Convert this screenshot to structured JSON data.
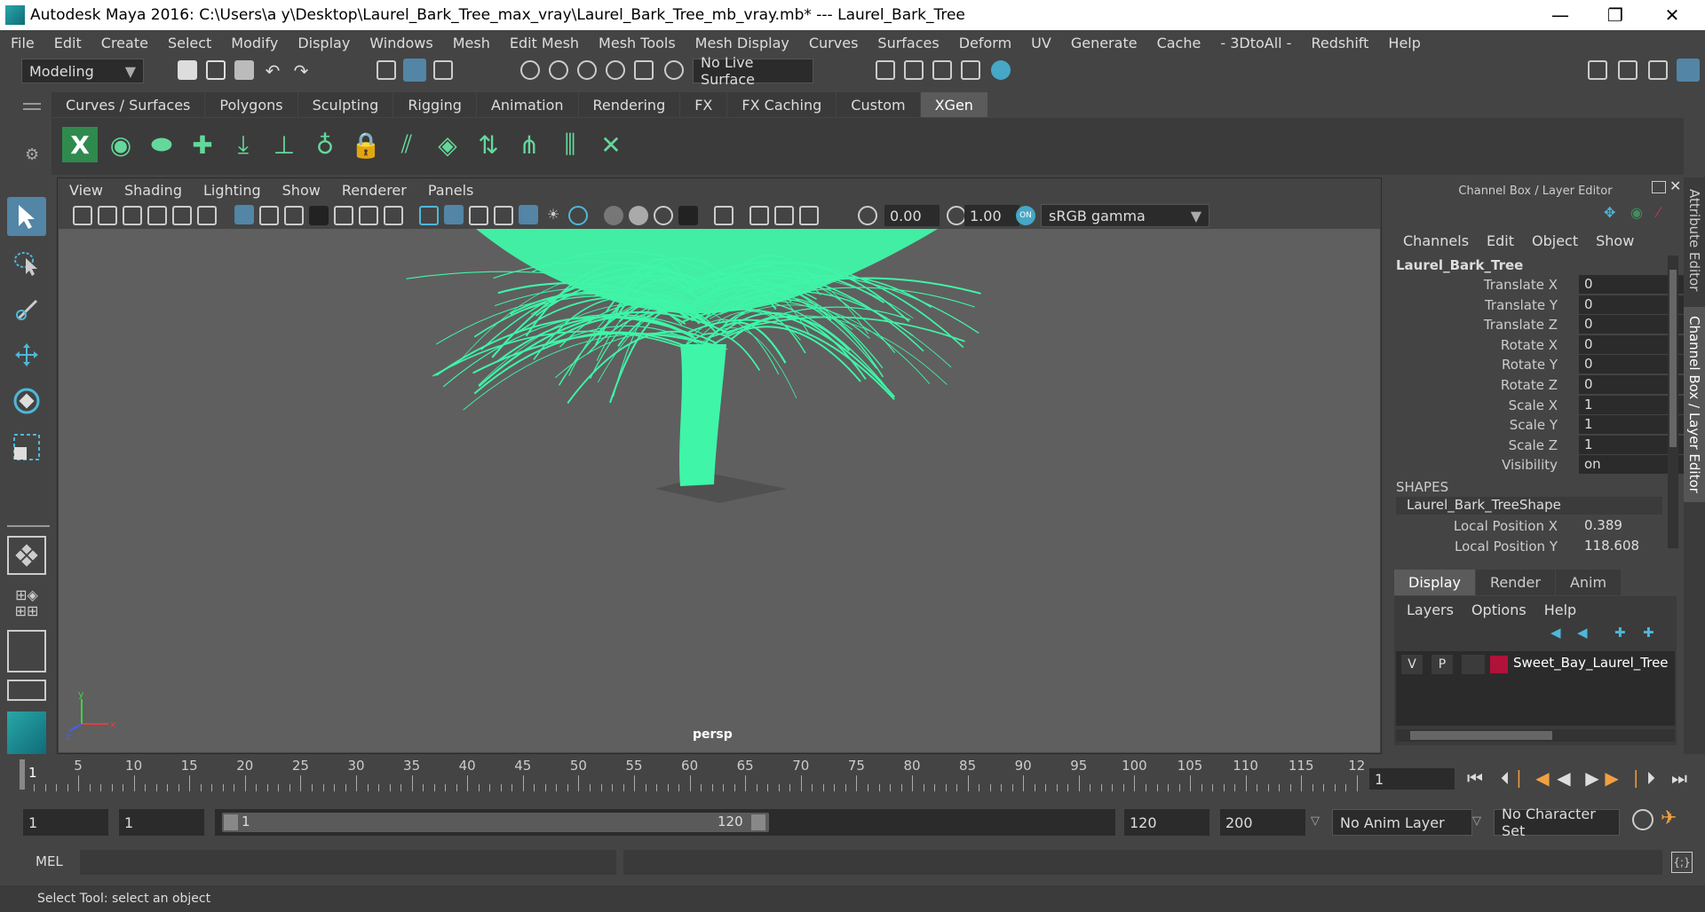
{
  "window": {
    "title": "Autodesk Maya 2016: C:\\Users\\a y\\Desktop\\Laurel_Bark_Tree_max_vray\\Laurel_Bark_Tree_mb_vray.mb*   ---   Laurel_Bark_Tree",
    "minimize": "—",
    "maximize": "❐",
    "close": "✕"
  },
  "menubar": [
    "File",
    "Edit",
    "Create",
    "Select",
    "Modify",
    "Display",
    "Windows",
    "Mesh",
    "Edit Mesh",
    "Mesh Tools",
    "Mesh Display",
    "Curves",
    "Surfaces",
    "Deform",
    "UV",
    "Generate",
    "Cache",
    "- 3DtoAll -",
    "Redshift",
    "Help"
  ],
  "toolbar": {
    "menuset": "Modeling",
    "live_surface": "No Live Surface"
  },
  "shelf_tabs": [
    {
      "label": "Curves / Surfaces",
      "active": false
    },
    {
      "label": "Polygons",
      "active": false
    },
    {
      "label": "Sculpting",
      "active": false
    },
    {
      "label": "Rigging",
      "active": false
    },
    {
      "label": "Animation",
      "active": false
    },
    {
      "label": "Rendering",
      "active": false
    },
    {
      "label": "FX",
      "active": false
    },
    {
      "label": "FX Caching",
      "active": false
    },
    {
      "label": "Custom",
      "active": false
    },
    {
      "label": "XGen",
      "active": true
    }
  ],
  "viewport": {
    "menu": [
      "View",
      "Shading",
      "Lighting",
      "Show",
      "Renderer",
      "Panels"
    ],
    "exposure": "0.00",
    "gamma": "1.00",
    "color_space": "sRGB gamma",
    "camera_label": "persp",
    "axis_x": "x",
    "axis_y": "y",
    "axis_z": "z",
    "wireframe_color": "#3ff5a8"
  },
  "channel_box": {
    "title": "Channel Box / Layer Editor",
    "menu": [
      "Channels",
      "Edit",
      "Object",
      "Show"
    ],
    "object": "Laurel_Bark_Tree",
    "channels": [
      {
        "label": "Translate X",
        "value": "0"
      },
      {
        "label": "Translate Y",
        "value": "0"
      },
      {
        "label": "Translate Z",
        "value": "0"
      },
      {
        "label": "Rotate X",
        "value": "0"
      },
      {
        "label": "Rotate Y",
        "value": "0"
      },
      {
        "label": "Rotate Z",
        "value": "0"
      },
      {
        "label": "Scale X",
        "value": "1"
      },
      {
        "label": "Scale Y",
        "value": "1"
      },
      {
        "label": "Scale Z",
        "value": "1"
      },
      {
        "label": "Visibility",
        "value": "on"
      }
    ],
    "shapes_header": "SHAPES",
    "shape_name": "Laurel_Bark_TreeShape",
    "shape_channels": [
      {
        "label": "Local Position X",
        "value": "0.389"
      },
      {
        "label": "Local Position Y",
        "value": "118.608"
      }
    ]
  },
  "layer_editor": {
    "tabs": [
      "Display",
      "Render",
      "Anim"
    ],
    "menu": [
      "Layers",
      "Options",
      "Help"
    ],
    "layer": {
      "v": "V",
      "p": "P",
      "name": "Sweet_Bay_Laurel_Tree",
      "color": "#b0123a"
    }
  },
  "side_tabs": [
    "Attribute Editor",
    "Channel Box / Layer Editor"
  ],
  "timeline": {
    "ticks": [
      "5",
      "10",
      "15",
      "20",
      "25",
      "30",
      "35",
      "40",
      "45",
      "50",
      "55",
      "60",
      "65",
      "70",
      "75",
      "80",
      "85",
      "90",
      "95",
      "100",
      "105",
      "110",
      "115",
      "12"
    ],
    "start_marker": "1",
    "current_frame": "1"
  },
  "range": {
    "start": "1",
    "playback_start": "1",
    "slider_start": "1",
    "slider_end": "120",
    "playback_end": "120",
    "end": "200",
    "anim_layer": "No Anim Layer",
    "character_set": "No Character Set"
  },
  "command_line": {
    "language": "MEL"
  },
  "help_line": "Select Tool: select an object"
}
